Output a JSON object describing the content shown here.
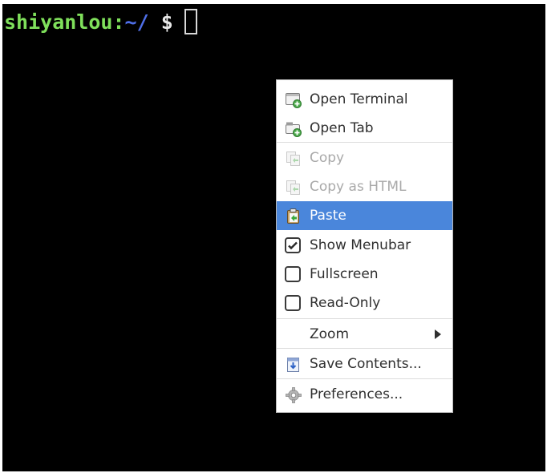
{
  "terminal": {
    "prompt": {
      "user": "shiyanlou",
      "separator": ":",
      "path": "~/",
      "symbol": " $"
    },
    "colors": {
      "background": "#000000",
      "user": "#7fe05b",
      "path": "#4f6fe8",
      "symbol": "#e8e8e8"
    }
  },
  "menu": {
    "highlight_color": "#4a86db",
    "items": [
      {
        "label": "Open Terminal",
        "icon": "terminal-add-icon",
        "enabled": true
      },
      {
        "label": "Open Tab",
        "icon": "tab-add-icon",
        "enabled": true
      },
      {
        "label": "Copy",
        "icon": "copy-icon",
        "enabled": false
      },
      {
        "label": "Copy as HTML",
        "icon": "copy-html-icon",
        "enabled": false
      },
      {
        "label": "Paste",
        "icon": "paste-icon",
        "enabled": true,
        "highlighted": true
      },
      {
        "label": "Show Menubar",
        "icon": "checkbox",
        "checked": true
      },
      {
        "label": "Fullscreen",
        "icon": "checkbox",
        "checked": false
      },
      {
        "label": "Read-Only",
        "icon": "checkbox",
        "checked": false
      },
      {
        "label": "Zoom",
        "icon": "submenu-arrow-icon",
        "has_submenu": true
      },
      {
        "label": "Save Contents...",
        "icon": "save-icon",
        "enabled": true
      },
      {
        "label": "Preferences...",
        "icon": "gear-icon",
        "enabled": true
      }
    ]
  }
}
